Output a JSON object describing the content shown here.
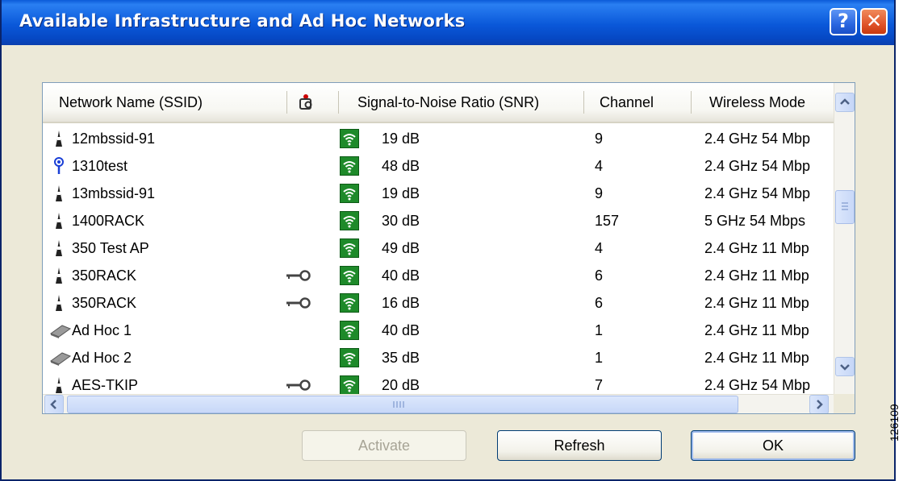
{
  "window": {
    "title": "Available Infrastructure and Ad Hoc Networks",
    "help_label": "?",
    "close_label": "✕"
  },
  "columns": {
    "ssid": "Network Name (SSID)",
    "security_icon": "encryption-key-icon",
    "snr": "Signal-to-Noise Ratio (SNR)",
    "channel": "Channel",
    "mode": "Wireless Mode"
  },
  "networks": [
    {
      "icon": "access-point-icon",
      "ssid": "12mbssid-91",
      "encrypted": false,
      "snr": "19 dB",
      "channel": "9",
      "mode": "2.4 GHz 54 Mbp"
    },
    {
      "icon": "repeater-antenna-icon",
      "ssid": "1310test",
      "encrypted": false,
      "snr": "48 dB",
      "channel": "4",
      "mode": "2.4 GHz 54 Mbp"
    },
    {
      "icon": "access-point-icon",
      "ssid": "13mbssid-91",
      "encrypted": false,
      "snr": "19 dB",
      "channel": "9",
      "mode": "2.4 GHz 54 Mbp"
    },
    {
      "icon": "access-point-icon",
      "ssid": "1400RACK",
      "encrypted": false,
      "snr": "30 dB",
      "channel": "157",
      "mode": "5 GHz 54 Mbps"
    },
    {
      "icon": "access-point-icon",
      "ssid": "350 Test AP",
      "encrypted": false,
      "snr": "49 dB",
      "channel": "4",
      "mode": "2.4 GHz 11 Mbp"
    },
    {
      "icon": "access-point-icon",
      "ssid": "350RACK",
      "encrypted": true,
      "snr": "40 dB",
      "channel": "6",
      "mode": "2.4 GHz 11 Mbp"
    },
    {
      "icon": "access-point-icon",
      "ssid": "350RACK",
      "encrypted": true,
      "snr": "16 dB",
      "channel": "6",
      "mode": "2.4 GHz 11 Mbp"
    },
    {
      "icon": "ad-hoc-card-icon",
      "ssid": "Ad Hoc 1",
      "encrypted": false,
      "snr": "40 dB",
      "channel": "1",
      "mode": "2.4 GHz 11 Mbp"
    },
    {
      "icon": "ad-hoc-card-icon",
      "ssid": "Ad Hoc 2",
      "encrypted": false,
      "snr": "35 dB",
      "channel": "1",
      "mode": "2.4 GHz 11 Mbp"
    },
    {
      "icon": "access-point-icon",
      "ssid": "AES-TKIP",
      "encrypted": true,
      "snr": "20 dB",
      "channel": "7",
      "mode": "2.4 GHz 54 Mbp"
    }
  ],
  "icons": {
    "signal": "wifi-signal-icon",
    "key": "key-icon"
  },
  "buttons": {
    "activate": "Activate",
    "refresh": "Refresh",
    "ok": "OK"
  },
  "figure_id": "126109",
  "colors": {
    "titlebar": "#0a58d9",
    "signal_bg": "#1e8a2a",
    "dialog_bg": "#ece9d8",
    "close": "#e0542a"
  }
}
